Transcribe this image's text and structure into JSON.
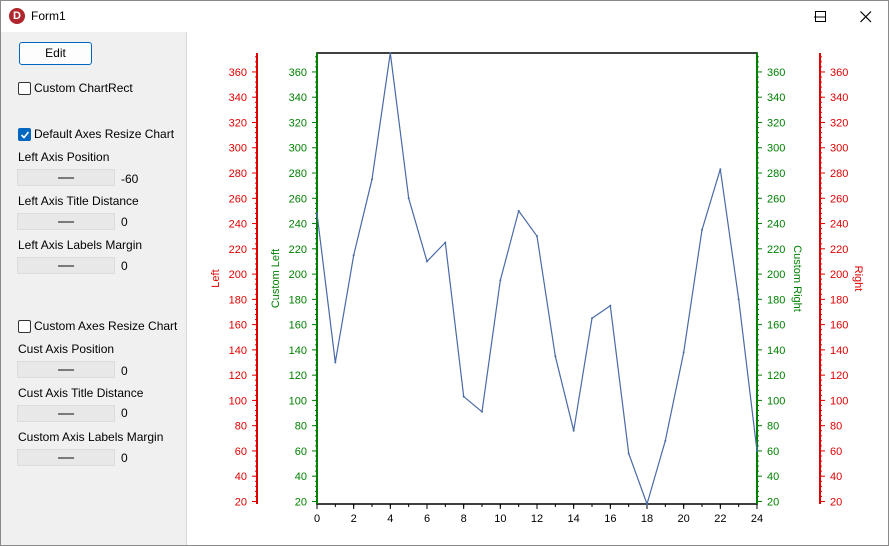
{
  "window": {
    "title": "Form1",
    "app_icon_letter": "D"
  },
  "panel": {
    "edit_label": "Edit",
    "custom_chartrect_label": "Custom ChartRect",
    "custom_chartrect_checked": false,
    "default_axes_label": "Default Axes Resize Chart",
    "default_axes_checked": true,
    "left_axis_position_label": "Left Axis Position",
    "left_axis_position_value": "-60",
    "left_axis_title_distance_label": "Left Axis Title Distance",
    "left_axis_title_distance_value": "0",
    "left_axis_labels_margin_label": "Left Axis Labels Margin",
    "left_axis_labels_margin_value": "0",
    "custom_axes_label": "Custom Axes Resize Chart",
    "custom_axes_checked": false,
    "cust_axis_position_label": "Cust Axis Position",
    "cust_axis_position_value": "0",
    "cust_axis_title_distance_label": "Cust Axis Title Distance",
    "cust_axis_title_distance_value": "0",
    "custom_axis_labels_margin_label": "Custom Axis Labels Margin",
    "custom_axis_labels_margin_value": "0"
  },
  "chart_data": {
    "type": "line",
    "x": [
      0,
      1,
      2,
      3,
      4,
      5,
      6,
      7,
      8,
      9,
      10,
      11,
      12,
      13,
      14,
      15,
      16,
      17,
      18,
      19,
      20,
      21,
      22,
      23,
      24
    ],
    "series": [
      {
        "values": [
          248,
          130,
          215,
          275,
          375,
          260,
          210,
          225,
          103,
          91,
          195,
          250,
          230,
          135,
          76,
          165,
          175,
          58,
          18,
          68,
          138,
          235,
          283,
          180,
          60
        ]
      }
    ],
    "xlim": [
      0,
      24
    ],
    "ylim": [
      18,
      375
    ],
    "x_ticks": [
      0,
      2,
      4,
      6,
      8,
      10,
      12,
      14,
      16,
      18,
      20,
      22,
      24
    ],
    "y_ticks": [
      20,
      40,
      60,
      80,
      100,
      120,
      140,
      160,
      180,
      200,
      220,
      240,
      260,
      280,
      300,
      320,
      340,
      360
    ],
    "axes": {
      "left": {
        "title": "Left",
        "color": "#e00000"
      },
      "custom_left": {
        "title": "Custom Left",
        "color": "#008000"
      },
      "custom_right": {
        "title": "Custom Right",
        "color": "#008000"
      },
      "right": {
        "title": "Right",
        "color": "#e00000"
      }
    },
    "series_color": "#4a6aa5",
    "grid": false
  }
}
